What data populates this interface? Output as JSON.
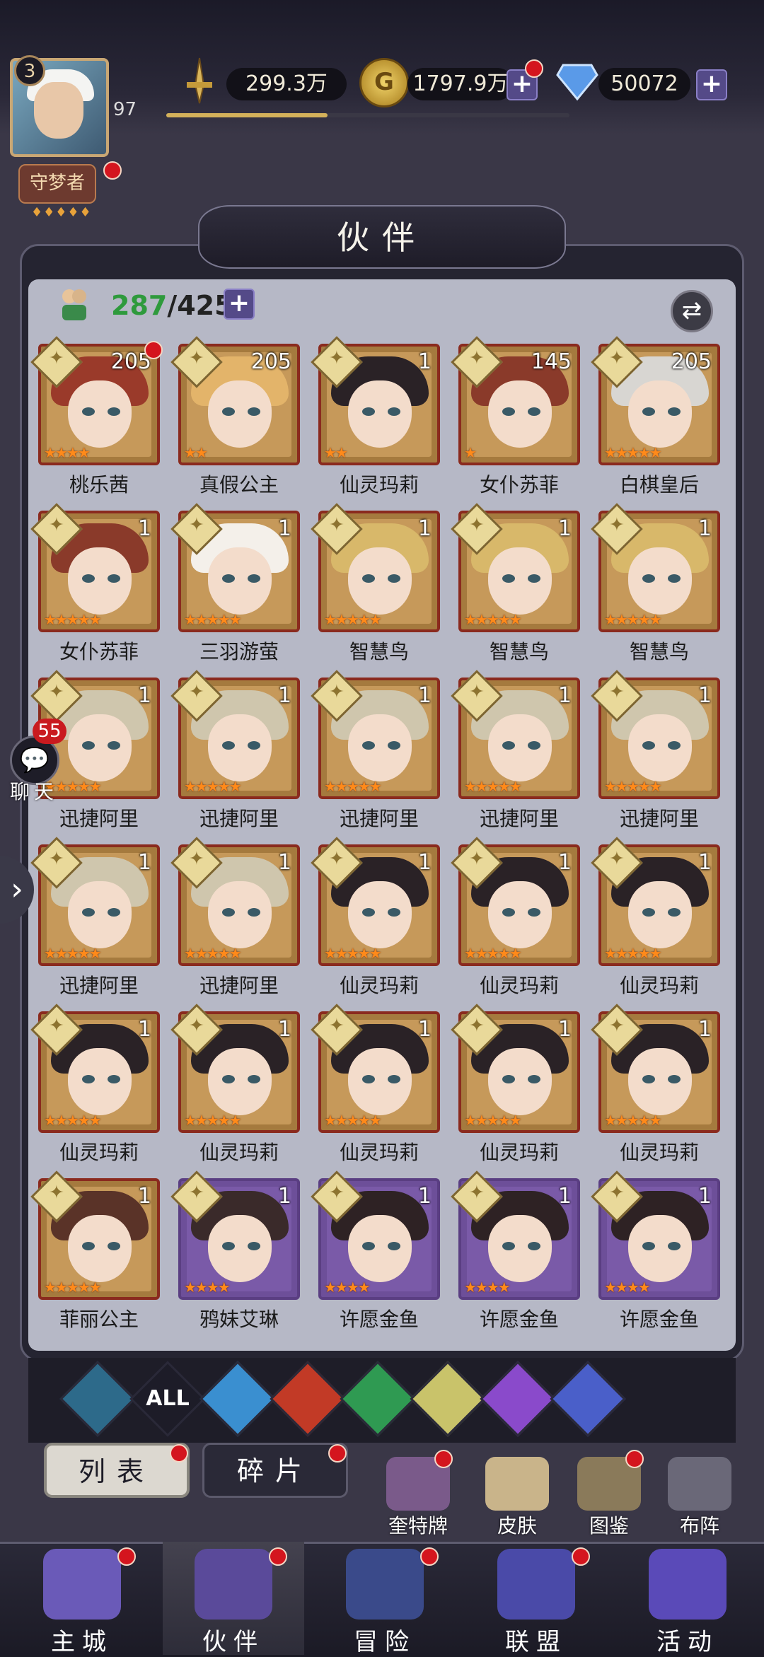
{
  "player": {
    "level": "3",
    "exp_level": "97",
    "exp_progress": 0.4,
    "title": "守梦者",
    "title_stars": "♦♦♦♦♦"
  },
  "resources": {
    "power": "299.3万",
    "gold": "1797.9万",
    "diamonds": "50072"
  },
  "header": {
    "title": "伙伴"
  },
  "roster": {
    "current": "287",
    "max": "/425"
  },
  "chat": {
    "count": "55",
    "label": "聊天"
  },
  "cards": [
    {
      "name": "桃乐茜",
      "level": "205",
      "stars": 4,
      "frame": "gold",
      "hair": "#9a3a2a",
      "dot": true
    },
    {
      "name": "真假公主",
      "level": "205",
      "stars": 2,
      "frame": "gold",
      "hair": "#e3b46a",
      "dot": false
    },
    {
      "name": "仙灵玛莉",
      "level": "1",
      "stars": 2,
      "frame": "gold",
      "hair": "#2a2226",
      "dot": false
    },
    {
      "name": "女仆苏菲",
      "level": "145",
      "stars": 1,
      "frame": "gold",
      "hair": "#8a3a2a",
      "dot": false
    },
    {
      "name": "白棋皇后",
      "level": "205",
      "stars": 5,
      "frame": "gold",
      "hair": "#d8d6d2",
      "dot": false
    },
    {
      "name": "女仆苏菲",
      "level": "1",
      "stars": 5,
      "frame": "gold",
      "hair": "#8a3a2a",
      "dot": false
    },
    {
      "name": "三羽游萤",
      "level": "1",
      "stars": 5,
      "frame": "gold",
      "hair": "#f4f0ea",
      "dot": false
    },
    {
      "name": "智慧鸟",
      "level": "1",
      "stars": 5,
      "frame": "gold",
      "hair": "#d8b86a",
      "dot": false
    },
    {
      "name": "智慧鸟",
      "level": "1",
      "stars": 5,
      "frame": "gold",
      "hair": "#d8b86a",
      "dot": false
    },
    {
      "name": "智慧鸟",
      "level": "1",
      "stars": 5,
      "frame": "gold",
      "hair": "#d8b86a",
      "dot": false
    },
    {
      "name": "迅捷阿里",
      "level": "1",
      "stars": 5,
      "frame": "gold",
      "hair": "#cfc6ad",
      "dot": false
    },
    {
      "name": "迅捷阿里",
      "level": "1",
      "stars": 5,
      "frame": "gold",
      "hair": "#cfc6ad",
      "dot": false
    },
    {
      "name": "迅捷阿里",
      "level": "1",
      "stars": 5,
      "frame": "gold",
      "hair": "#cfc6ad",
      "dot": false
    },
    {
      "name": "迅捷阿里",
      "level": "1",
      "stars": 5,
      "frame": "gold",
      "hair": "#cfc6ad",
      "dot": false
    },
    {
      "name": "迅捷阿里",
      "level": "1",
      "stars": 5,
      "frame": "gold",
      "hair": "#cfc6ad",
      "dot": false
    },
    {
      "name": "迅捷阿里",
      "level": "1",
      "stars": 5,
      "frame": "gold",
      "hair": "#cfc6ad",
      "dot": false
    },
    {
      "name": "迅捷阿里",
      "level": "1",
      "stars": 5,
      "frame": "gold",
      "hair": "#cfc6ad",
      "dot": false
    },
    {
      "name": "仙灵玛莉",
      "level": "1",
      "stars": 5,
      "frame": "gold",
      "hair": "#2a2226",
      "dot": false
    },
    {
      "name": "仙灵玛莉",
      "level": "1",
      "stars": 5,
      "frame": "gold",
      "hair": "#2a2226",
      "dot": false
    },
    {
      "name": "仙灵玛莉",
      "level": "1",
      "stars": 5,
      "frame": "gold",
      "hair": "#2a2226",
      "dot": false
    },
    {
      "name": "仙灵玛莉",
      "level": "1",
      "stars": 5,
      "frame": "gold",
      "hair": "#2a2226",
      "dot": false
    },
    {
      "name": "仙灵玛莉",
      "level": "1",
      "stars": 5,
      "frame": "gold",
      "hair": "#2a2226",
      "dot": false
    },
    {
      "name": "仙灵玛莉",
      "level": "1",
      "stars": 5,
      "frame": "gold",
      "hair": "#2a2226",
      "dot": false
    },
    {
      "name": "仙灵玛莉",
      "level": "1",
      "stars": 5,
      "frame": "gold",
      "hair": "#2a2226",
      "dot": false
    },
    {
      "name": "仙灵玛莉",
      "level": "1",
      "stars": 5,
      "frame": "gold",
      "hair": "#2a2226",
      "dot": false
    },
    {
      "name": "菲丽公主",
      "level": "1",
      "stars": 5,
      "frame": "gold",
      "hair": "#5a3328",
      "dot": false
    },
    {
      "name": "鸦妹艾琳",
      "level": "1",
      "stars": 4,
      "frame": "purple",
      "hair": "#3a2a2a",
      "dot": false
    },
    {
      "name": "许愿金鱼",
      "level": "1",
      "stars": 4,
      "frame": "purple",
      "hair": "#2e2224",
      "dot": false
    },
    {
      "name": "许愿金鱼",
      "level": "1",
      "stars": 4,
      "frame": "purple",
      "hair": "#2e2224",
      "dot": false
    },
    {
      "name": "许愿金鱼",
      "level": "1",
      "stars": 4,
      "frame": "purple",
      "hair": "#2e2224",
      "dot": false
    }
  ],
  "filters": [
    {
      "name": "filter-default-icon",
      "color": "#2d6a8a",
      "label": ""
    },
    {
      "name": "filter-all-icon",
      "color": "#1d1c28",
      "label": "ALL"
    },
    {
      "name": "filter-water-icon",
      "color": "#3a8fd0",
      "label": ""
    },
    {
      "name": "filter-fire-icon",
      "color": "#c23a26",
      "label": ""
    },
    {
      "name": "filter-wind-icon",
      "color": "#2f9a52",
      "label": ""
    },
    {
      "name": "filter-light-icon",
      "color": "#c9c36a",
      "label": ""
    },
    {
      "name": "filter-dark-icon",
      "color": "#8a4acb",
      "label": ""
    },
    {
      "name": "filter-void-icon",
      "color": "#4a5fc9",
      "label": ""
    }
  ],
  "tabs": {
    "list": "列表",
    "fragments": "碎片"
  },
  "functions": [
    {
      "label": "奎特牌",
      "color": "#7a5a8a",
      "dot": true
    },
    {
      "label": "皮肤",
      "color": "#c9b48a",
      "dot": false
    },
    {
      "label": "图鉴",
      "color": "#8a7a5a",
      "dot": true
    },
    {
      "label": "布阵",
      "color": "#6a6878",
      "dot": false
    }
  ],
  "nav": [
    {
      "label": "主城",
      "color": "#6a5ab8"
    },
    {
      "label": "伙伴",
      "color": "#5a4a9a"
    },
    {
      "label": "冒险",
      "color": "#3a4a8a"
    },
    {
      "label": "联盟",
      "color": "#4a4aa8"
    },
    {
      "label": "活动",
      "color": "#5a4ab8"
    }
  ]
}
